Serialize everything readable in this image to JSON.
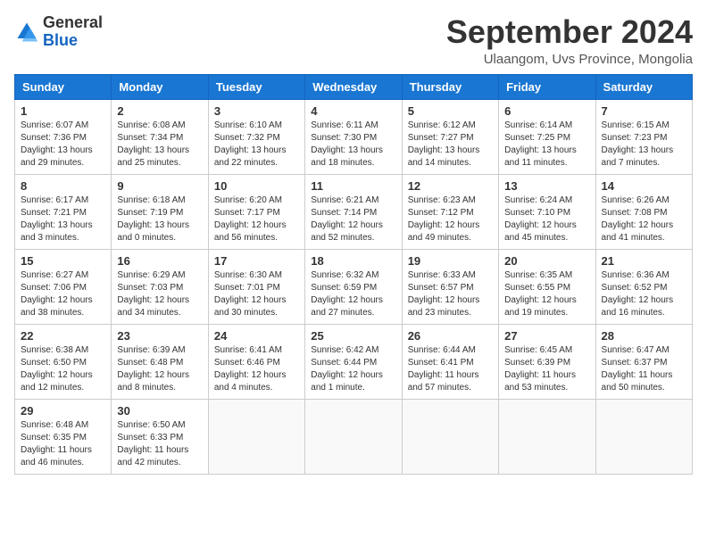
{
  "header": {
    "logo": {
      "line1": "General",
      "line2": "Blue"
    },
    "title": "September 2024",
    "subtitle": "Ulaangom, Uvs Province, Mongolia"
  },
  "days_of_week": [
    "Sunday",
    "Monday",
    "Tuesday",
    "Wednesday",
    "Thursday",
    "Friday",
    "Saturday"
  ],
  "weeks": [
    [
      {
        "day": "1",
        "info": "Sunrise: 6:07 AM\nSunset: 7:36 PM\nDaylight: 13 hours\nand 29 minutes."
      },
      {
        "day": "2",
        "info": "Sunrise: 6:08 AM\nSunset: 7:34 PM\nDaylight: 13 hours\nand 25 minutes."
      },
      {
        "day": "3",
        "info": "Sunrise: 6:10 AM\nSunset: 7:32 PM\nDaylight: 13 hours\nand 22 minutes."
      },
      {
        "day": "4",
        "info": "Sunrise: 6:11 AM\nSunset: 7:30 PM\nDaylight: 13 hours\nand 18 minutes."
      },
      {
        "day": "5",
        "info": "Sunrise: 6:12 AM\nSunset: 7:27 PM\nDaylight: 13 hours\nand 14 minutes."
      },
      {
        "day": "6",
        "info": "Sunrise: 6:14 AM\nSunset: 7:25 PM\nDaylight: 13 hours\nand 11 minutes."
      },
      {
        "day": "7",
        "info": "Sunrise: 6:15 AM\nSunset: 7:23 PM\nDaylight: 13 hours\nand 7 minutes."
      }
    ],
    [
      {
        "day": "8",
        "info": "Sunrise: 6:17 AM\nSunset: 7:21 PM\nDaylight: 13 hours\nand 3 minutes."
      },
      {
        "day": "9",
        "info": "Sunrise: 6:18 AM\nSunset: 7:19 PM\nDaylight: 13 hours\nand 0 minutes."
      },
      {
        "day": "10",
        "info": "Sunrise: 6:20 AM\nSunset: 7:17 PM\nDaylight: 12 hours\nand 56 minutes."
      },
      {
        "day": "11",
        "info": "Sunrise: 6:21 AM\nSunset: 7:14 PM\nDaylight: 12 hours\nand 52 minutes."
      },
      {
        "day": "12",
        "info": "Sunrise: 6:23 AM\nSunset: 7:12 PM\nDaylight: 12 hours\nand 49 minutes."
      },
      {
        "day": "13",
        "info": "Sunrise: 6:24 AM\nSunset: 7:10 PM\nDaylight: 12 hours\nand 45 minutes."
      },
      {
        "day": "14",
        "info": "Sunrise: 6:26 AM\nSunset: 7:08 PM\nDaylight: 12 hours\nand 41 minutes."
      }
    ],
    [
      {
        "day": "15",
        "info": "Sunrise: 6:27 AM\nSunset: 7:06 PM\nDaylight: 12 hours\nand 38 minutes."
      },
      {
        "day": "16",
        "info": "Sunrise: 6:29 AM\nSunset: 7:03 PM\nDaylight: 12 hours\nand 34 minutes."
      },
      {
        "day": "17",
        "info": "Sunrise: 6:30 AM\nSunset: 7:01 PM\nDaylight: 12 hours\nand 30 minutes."
      },
      {
        "day": "18",
        "info": "Sunrise: 6:32 AM\nSunset: 6:59 PM\nDaylight: 12 hours\nand 27 minutes."
      },
      {
        "day": "19",
        "info": "Sunrise: 6:33 AM\nSunset: 6:57 PM\nDaylight: 12 hours\nand 23 minutes."
      },
      {
        "day": "20",
        "info": "Sunrise: 6:35 AM\nSunset: 6:55 PM\nDaylight: 12 hours\nand 19 minutes."
      },
      {
        "day": "21",
        "info": "Sunrise: 6:36 AM\nSunset: 6:52 PM\nDaylight: 12 hours\nand 16 minutes."
      }
    ],
    [
      {
        "day": "22",
        "info": "Sunrise: 6:38 AM\nSunset: 6:50 PM\nDaylight: 12 hours\nand 12 minutes."
      },
      {
        "day": "23",
        "info": "Sunrise: 6:39 AM\nSunset: 6:48 PM\nDaylight: 12 hours\nand 8 minutes."
      },
      {
        "day": "24",
        "info": "Sunrise: 6:41 AM\nSunset: 6:46 PM\nDaylight: 12 hours\nand 4 minutes."
      },
      {
        "day": "25",
        "info": "Sunrise: 6:42 AM\nSunset: 6:44 PM\nDaylight: 12 hours\nand 1 minute."
      },
      {
        "day": "26",
        "info": "Sunrise: 6:44 AM\nSunset: 6:41 PM\nDaylight: 11 hours\nand 57 minutes."
      },
      {
        "day": "27",
        "info": "Sunrise: 6:45 AM\nSunset: 6:39 PM\nDaylight: 11 hours\nand 53 minutes."
      },
      {
        "day": "28",
        "info": "Sunrise: 6:47 AM\nSunset: 6:37 PM\nDaylight: 11 hours\nand 50 minutes."
      }
    ],
    [
      {
        "day": "29",
        "info": "Sunrise: 6:48 AM\nSunset: 6:35 PM\nDaylight: 11 hours\nand 46 minutes."
      },
      {
        "day": "30",
        "info": "Sunrise: 6:50 AM\nSunset: 6:33 PM\nDaylight: 11 hours\nand 42 minutes."
      },
      {
        "day": "",
        "info": ""
      },
      {
        "day": "",
        "info": ""
      },
      {
        "day": "",
        "info": ""
      },
      {
        "day": "",
        "info": ""
      },
      {
        "day": "",
        "info": ""
      }
    ]
  ]
}
